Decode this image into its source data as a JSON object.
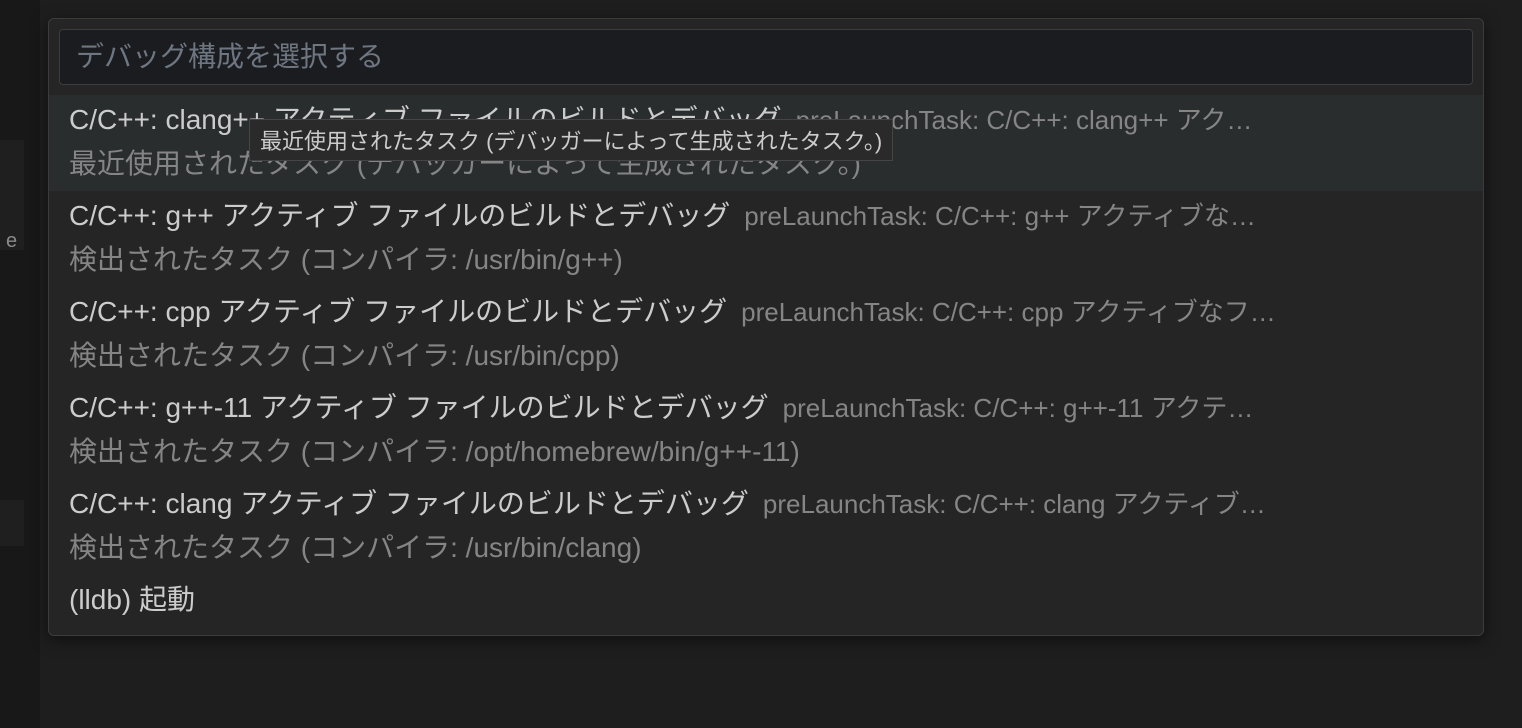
{
  "quickpick": {
    "placeholder": "デバッグ構成を選択する",
    "tooltip": "最近使用されたタスク (デバッガーによって生成されたタスク。)",
    "items": [
      {
        "label": "C/C++: clang++ アクティブ ファイルのビルドとデバッグ",
        "description": "preLaunchTask: C/C++: clang++ アク…",
        "detail": "最近使用されたタスク (デバッガーによって生成されたタスク。)",
        "highlighted": true
      },
      {
        "label": "C/C++: g++ アクティブ ファイルのビルドとデバッグ",
        "description": "preLaunchTask: C/C++: g++ アクティブな…",
        "detail": "検出されたタスク (コンパイラ: /usr/bin/g++)",
        "highlighted": false
      },
      {
        "label": "C/C++: cpp アクティブ ファイルのビルドとデバッグ",
        "description": "preLaunchTask: C/C++: cpp アクティブなフ…",
        "detail": "検出されたタスク (コンパイラ: /usr/bin/cpp)",
        "highlighted": false
      },
      {
        "label": "C/C++: g++-11 アクティブ ファイルのビルドとデバッグ",
        "description": "preLaunchTask: C/C++: g++-11 アクテ…",
        "detail": "検出されたタスク (コンパイラ: /opt/homebrew/bin/g++-11)",
        "highlighted": false
      },
      {
        "label": "C/C++: clang アクティブ ファイルのビルドとデバッグ",
        "description": "preLaunchTask: C/C++: clang アクティブ…",
        "detail": "検出されたタスク (コンパイラ: /usr/bin/clang)",
        "highlighted": false
      },
      {
        "label": "(lldb) 起動",
        "description": "",
        "detail": "",
        "highlighted": false
      }
    ]
  },
  "left_label": "e"
}
